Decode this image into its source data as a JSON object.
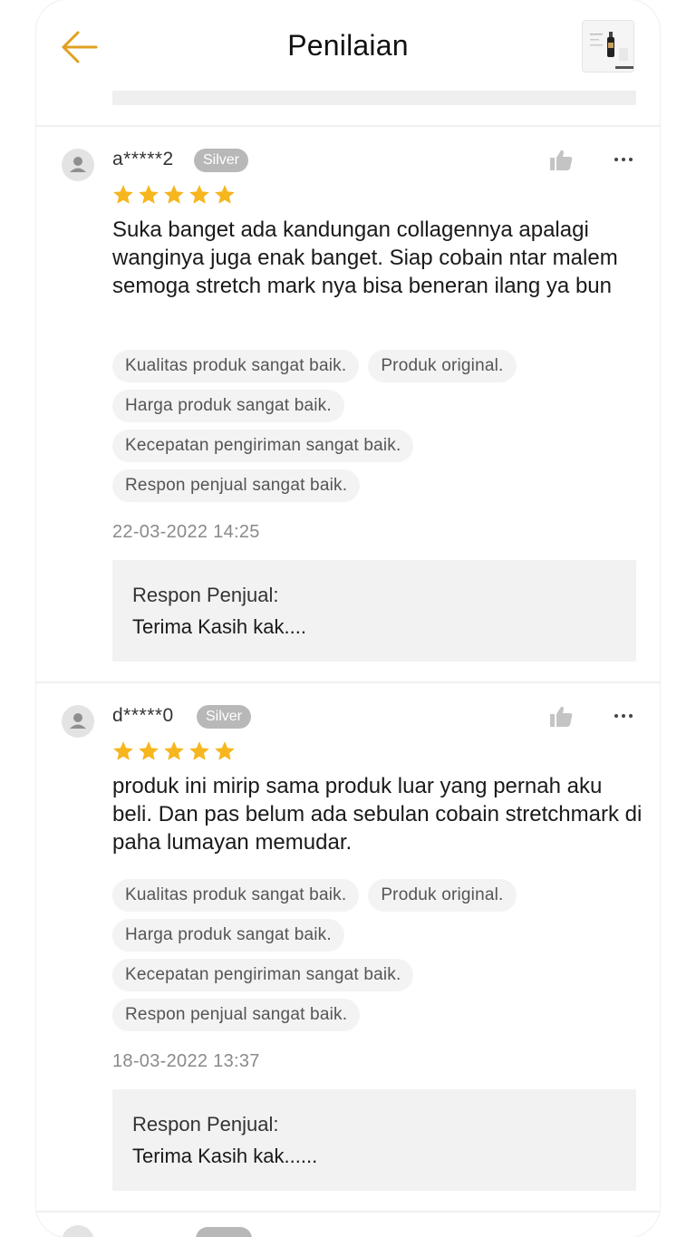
{
  "header": {
    "title": "Penilaian",
    "back_icon": "arrow-left-icon",
    "accent_color": "#e0a020"
  },
  "reviews": [
    {
      "username": "a*****2",
      "tier": "Silver",
      "rating": 5,
      "comment": "Suka banget ada kandungan collagennya apalagi wanginya juga enak banget. Siap cobain ntar malem semoga stretch mark nya bisa beneran ilang ya bun",
      "tags": [
        "Kualitas produk sangat baik.",
        "Produk original.",
        "Harga produk sangat baik.",
        "Kecepatan pengiriman sangat baik.",
        "Respon penjual sangat baik."
      ],
      "date": "22-03-2022 14:25",
      "seller_response_label": "Respon Penjual:",
      "seller_response": "Terima Kasih kak...."
    },
    {
      "username": "d*****0",
      "tier": "Silver",
      "rating": 5,
      "comment": "produk ini mirip sama produk luar yang pernah aku beli. Dan pas belum ada sebulan cobain stretchmark di paha lumayan memudar.",
      "tags": [
        "Kualitas produk sangat baik.",
        "Produk original.",
        "Harga produk sangat baik.",
        "Kecepatan pengiriman sangat baik.",
        "Respon penjual sangat baik."
      ],
      "date": "18-03-2022 13:37",
      "seller_response_label": "Respon Penjual:",
      "seller_response": "Terima Kasih kak......"
    }
  ],
  "colors": {
    "star": "#f6b61e",
    "badge": "#b8b8b8",
    "tag_bg": "#f3f3f3",
    "seller_bg": "#f2f2f2"
  }
}
